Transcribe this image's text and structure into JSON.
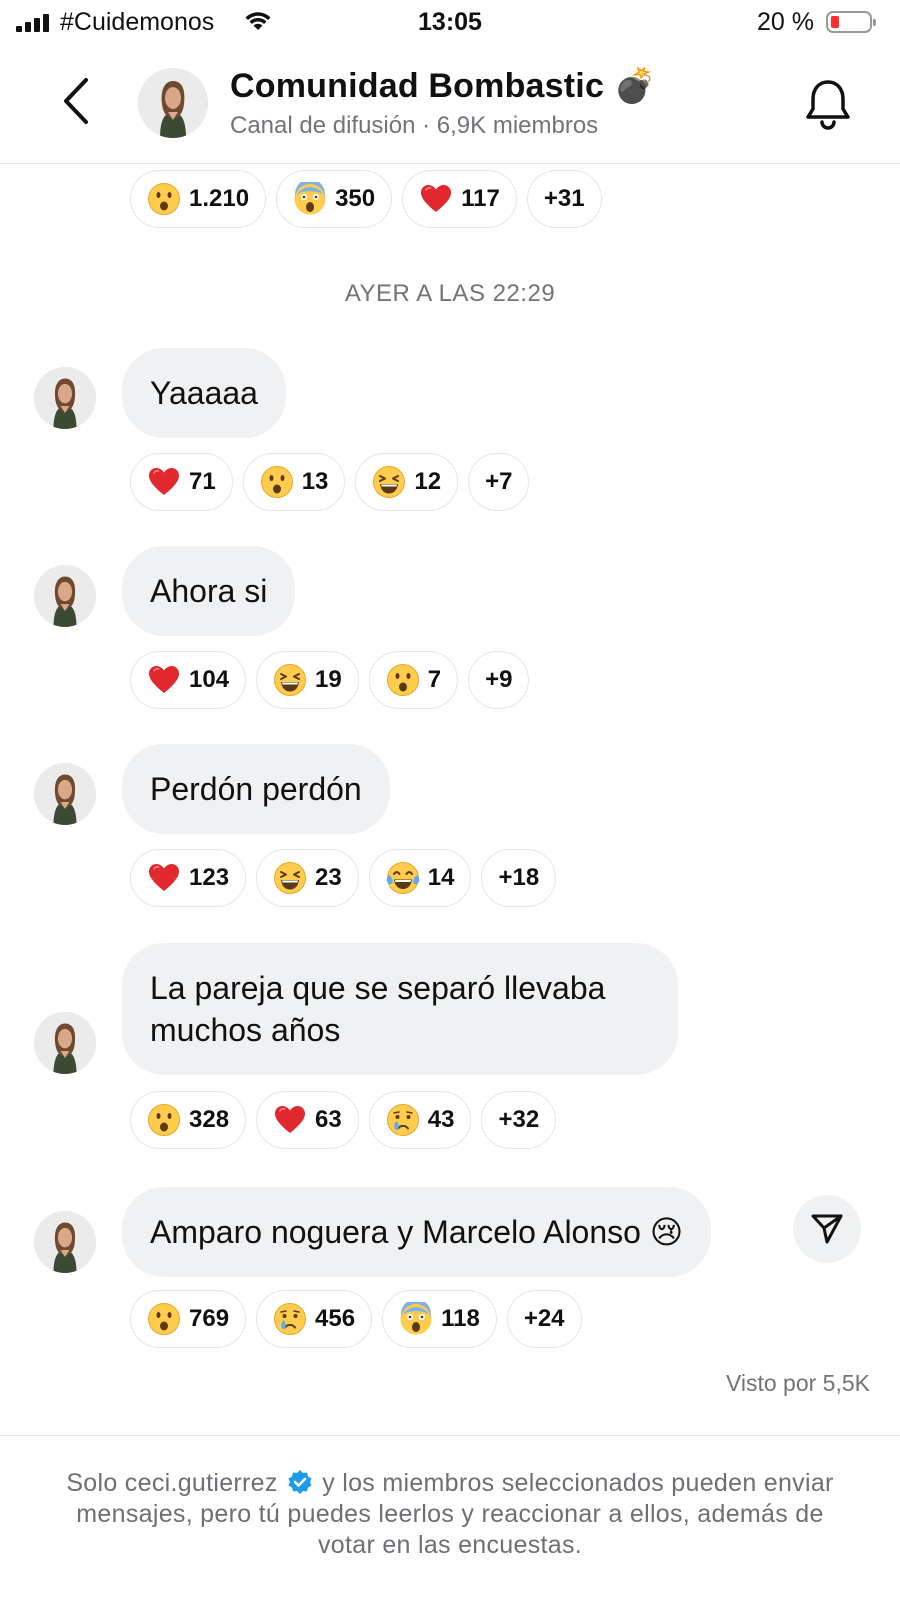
{
  "status_bar": {
    "carrier": "#Cuidemonos",
    "time": "13:05",
    "battery": "20 %",
    "battery_level": 0.2
  },
  "header": {
    "channel_name": "Comunidad Bombastic 💣",
    "subtitle": "Canal de difusión · 6,9K miembros"
  },
  "top_reactions": [
    {
      "emoji": "surprised-face",
      "count": "1.210"
    },
    {
      "emoji": "screaming-face",
      "count": "350"
    },
    {
      "emoji": "red-heart",
      "count": "117"
    },
    {
      "count": "+31"
    }
  ],
  "date_separator": "AYER A LAS 22:29",
  "messages": [
    {
      "text": "Yaaaaa",
      "reactions": [
        {
          "emoji": "red-heart",
          "count": "71"
        },
        {
          "emoji": "surprised-face",
          "count": "13"
        },
        {
          "emoji": "laughing-face",
          "count": "12"
        },
        {
          "count": "+7"
        }
      ]
    },
    {
      "text": "Ahora si",
      "reactions": [
        {
          "emoji": "red-heart",
          "count": "104"
        },
        {
          "emoji": "laughing-face",
          "count": "19"
        },
        {
          "emoji": "surprised-face",
          "count": "7"
        },
        {
          "count": "+9"
        }
      ]
    },
    {
      "text": "Perdón perdón",
      "reactions": [
        {
          "emoji": "red-heart",
          "count": "123"
        },
        {
          "emoji": "laughing-face",
          "count": "23"
        },
        {
          "emoji": "tears-of-joy-face",
          "count": "14"
        },
        {
          "count": "+18"
        }
      ]
    },
    {
      "text": "La pareja que se separó llevaba muchos años",
      "reactions": [
        {
          "emoji": "surprised-face",
          "count": "328"
        },
        {
          "emoji": "red-heart",
          "count": "63"
        },
        {
          "emoji": "crying-face",
          "count": "43"
        },
        {
          "count": "+32"
        }
      ]
    },
    {
      "text": "Amparo noguera y Marcelo Alonso 😢",
      "reactions": [
        {
          "emoji": "surprised-face",
          "count": "769"
        },
        {
          "emoji": "crying-face",
          "count": "456"
        },
        {
          "emoji": "screaming-face",
          "count": "118"
        },
        {
          "count": "+24"
        }
      ]
    }
  ],
  "seen_by": "Visto por 5,5K",
  "footer": {
    "before": "Solo ceci.gutierrez",
    "after": "y los miembros seleccionados pueden enviar mensajes, pero tú puedes leerlos y reaccionar a ellos, además de votar en las encuestas."
  }
}
